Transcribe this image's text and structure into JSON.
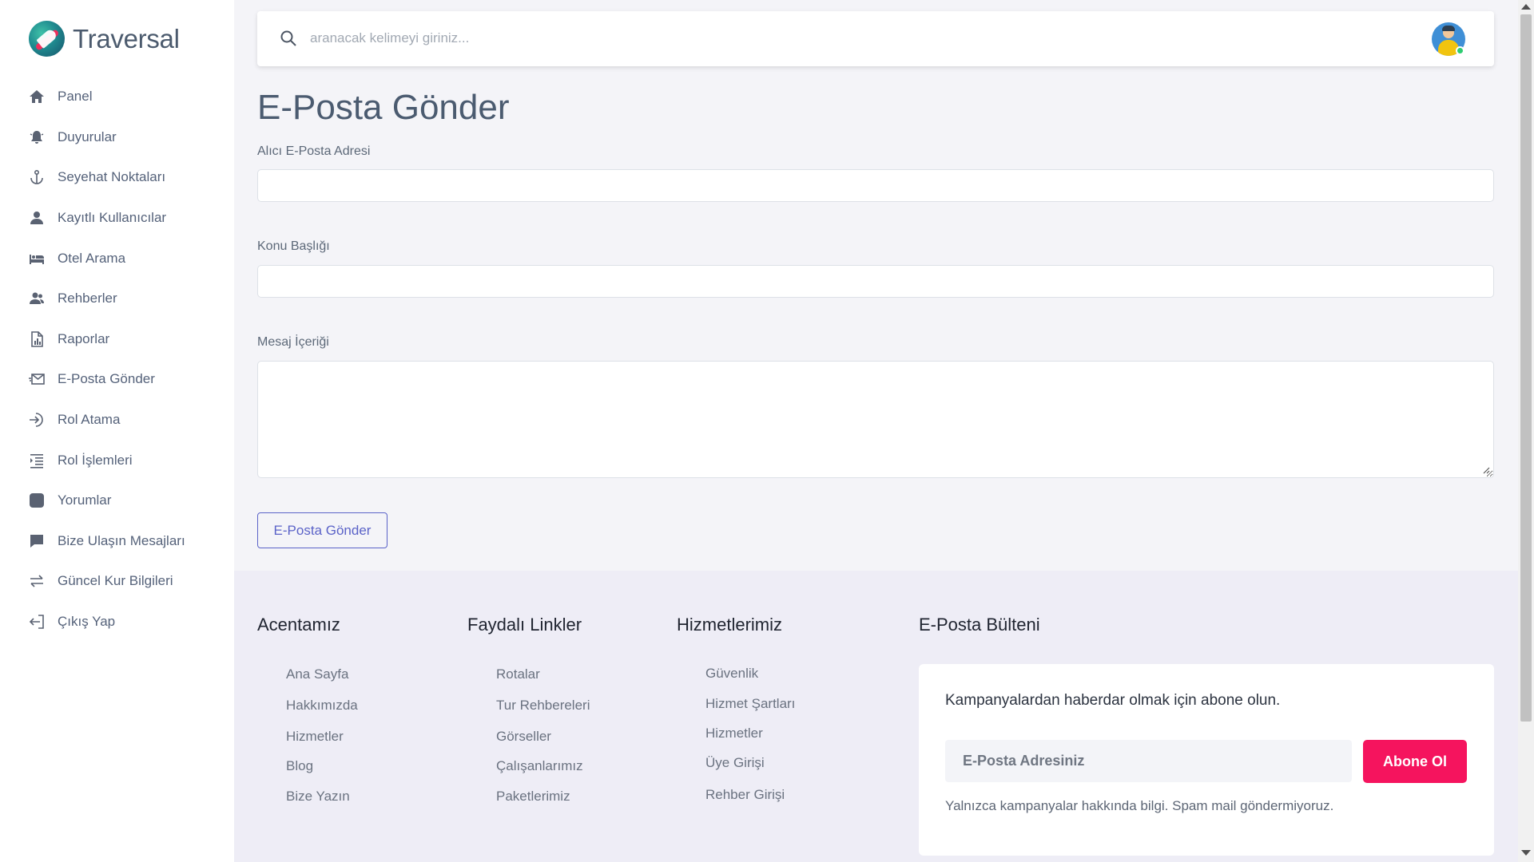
{
  "brand": {
    "name": "Traversal"
  },
  "sidebar": {
    "items": [
      {
        "label": "Panel",
        "icon": "home-icon"
      },
      {
        "label": "Duyurular",
        "icon": "bell-icon"
      },
      {
        "label": "Seyehat Noktaları",
        "icon": "anchor-icon"
      },
      {
        "label": "Kayıtlı Kullanıcılar",
        "icon": "user-icon"
      },
      {
        "label": "Otel Arama",
        "icon": "bed-icon"
      },
      {
        "label": "Rehberler",
        "icon": "users-icon"
      },
      {
        "label": "Raporlar",
        "icon": "report-icon"
      },
      {
        "label": "E-Posta Gönder",
        "icon": "mail-send-icon"
      },
      {
        "label": "Rol Atama",
        "icon": "login-icon"
      },
      {
        "label": "Rol İşlemleri",
        "icon": "list-indent-icon"
      },
      {
        "label": "Yorumlar",
        "icon": "comment-square-icon"
      },
      {
        "label": "Bize Ulaşın Mesajları",
        "icon": "chat-icon"
      },
      {
        "label": "Güncel Kur Bilgileri",
        "icon": "exchange-icon"
      },
      {
        "label": "Çıkış Yap",
        "icon": "logout-icon"
      }
    ]
  },
  "topbar": {
    "search_placeholder": "aranacak kelimeyi giriniz..."
  },
  "main": {
    "title": "E-Posta Gönder",
    "fields": {
      "recipient_label": "Alıcı E-Posta Adresi",
      "recipient_value": "",
      "subject_label": "Konu Başlığı",
      "subject_value": "",
      "message_label": "Mesaj İçeriği",
      "message_value": ""
    },
    "send_button": "E-Posta Gönder"
  },
  "footer": {
    "agency": {
      "title": "Acentamız",
      "links": [
        "Ana Sayfa",
        "Hakkımızda",
        "Hizmetler",
        "Blog",
        "Bize Yazın"
      ]
    },
    "useful": {
      "title": "Faydalı Linkler",
      "links": [
        "Rotalar",
        "Tur Rehbereleri",
        "Görseller",
        "Çalışanlarımız",
        "Paketlerimiz"
      ]
    },
    "services": {
      "title": "Hizmetlerimiz",
      "links": [
        "Güvenlik",
        "Hizmet Şartları",
        "Hizmetler",
        "Üye Girişi",
        "Rehber Girişi"
      ]
    },
    "newsletter": {
      "title": "E-Posta Bülteni",
      "text": "Kampanyalardan haberdar olmak için abone olun.",
      "placeholder": "E-Posta Adresiniz",
      "button": "Abone Ol",
      "note": "Yalnızca kampanyalar hakkında bilgi. Spam mail göndermiyoruz."
    }
  },
  "colors": {
    "accent": "#5b63c8",
    "subscribe": "#f5145e",
    "online_status": "#2ecc71"
  }
}
